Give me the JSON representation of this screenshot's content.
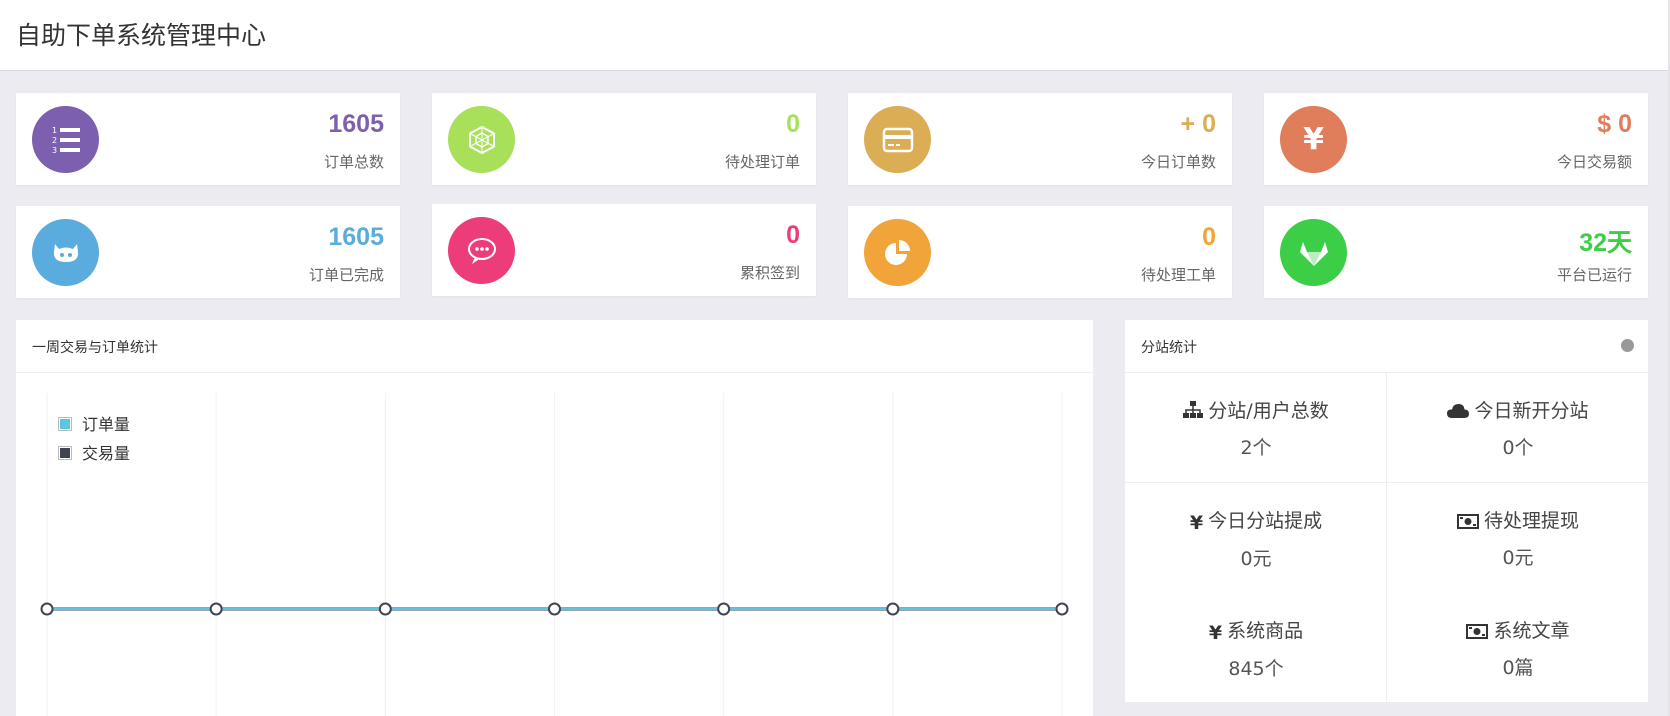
{
  "header": {
    "title": "自助下单系统管理中心"
  },
  "cards": [
    {
      "value": "1605",
      "label": "订单总数",
      "color": "#7d5fb0",
      "icon": "ordered-list-icon"
    },
    {
      "value": "0",
      "label": "待处理订单",
      "color": "#a8e05a",
      "icon": "hexagon-icon"
    },
    {
      "value": "+ 0",
      "label": "今日订单数",
      "color": "#dbad55",
      "icon": "credit-card-icon"
    },
    {
      "value": "$ 0",
      "label": "今日交易额",
      "color": "#e07d5a",
      "icon": "yen-icon"
    },
    {
      "value": "1605",
      "label": "订单已完成",
      "color": "#5aacdf",
      "icon": "github-icon"
    },
    {
      "value": "0",
      "label": "累积签到",
      "color": "#ec3d7a",
      "icon": "chat-bubble-icon"
    },
    {
      "value": "0",
      "label": "待处理工单",
      "color": "#f0a43a",
      "icon": "pie-chart-icon"
    },
    {
      "value": "32天",
      "label": "平台已运行",
      "color": "#3cce46",
      "icon": "gitlab-icon"
    }
  ],
  "chart_panel": {
    "title": "一周交易与订单统计",
    "legend": [
      {
        "name": "订单量",
        "color": "#5bc6e0"
      },
      {
        "name": "交易量",
        "color": "#3f4450"
      }
    ]
  },
  "chart_data": {
    "type": "line",
    "x": [
      "",
      "",
      "",
      "",
      "",
      "",
      ""
    ],
    "series": [
      {
        "name": "订单量",
        "values": [
          0,
          0,
          0,
          0,
          0,
          0,
          0
        ],
        "color": "#5bc6e0"
      },
      {
        "name": "交易量",
        "values": [
          0,
          0,
          0,
          0,
          0,
          0,
          0
        ],
        "color": "#3f4450"
      }
    ],
    "grid": true,
    "legend_position": "top-left"
  },
  "stats_panel": {
    "title": "分站统计",
    "items": [
      {
        "label": "分站/用户总数",
        "value": "2个",
        "icon": "sitemap-icon"
      },
      {
        "label": "今日新开分站",
        "value": "0个",
        "icon": "cloud-icon"
      },
      {
        "label": "今日分站提成",
        "value": "0元",
        "icon": "yen-sign-icon"
      },
      {
        "label": "待处理提现",
        "value": "0元",
        "icon": "money-bill-icon"
      },
      {
        "label": "系统商品",
        "value": "845个",
        "icon": "yen-sign-icon"
      },
      {
        "label": "系统文章",
        "value": "0篇",
        "icon": "money-bill-icon"
      }
    ]
  }
}
